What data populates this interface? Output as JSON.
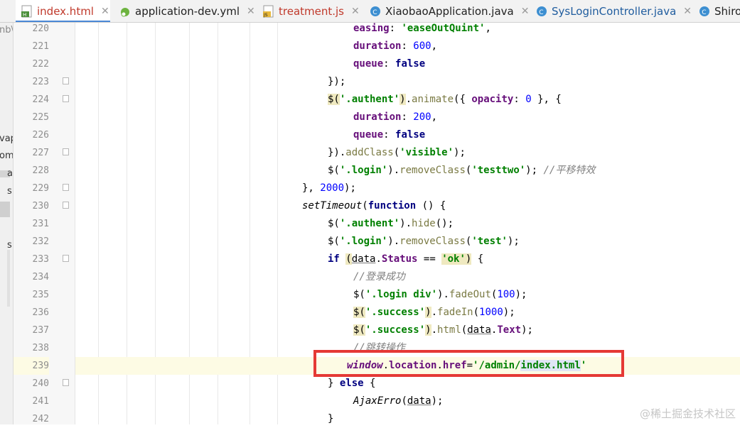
{
  "tabs": [
    {
      "label": "index.html",
      "icon": "html-file-icon",
      "modified": true,
      "active": true,
      "closable": true
    },
    {
      "label": "application-dev.yml",
      "icon": "yml-leaf-icon",
      "modified": false,
      "active": false,
      "closable": true
    },
    {
      "label": "treatment.js",
      "icon": "js-file-icon",
      "modified": true,
      "active": false,
      "closable": true
    },
    {
      "label": "XiaobaoApplication.java",
      "icon": "java-class-icon",
      "modified": false,
      "active": false,
      "closable": true
    },
    {
      "label": "SysLoginController.java",
      "icon": "java-class-icon",
      "modified": false,
      "active": false,
      "closable": true
    },
    {
      "label": "Shiro",
      "icon": "java-class-icon",
      "modified": false,
      "active": false,
      "closable": false
    }
  ],
  "side_fragments": [
    "nb\\",
    "vap",
    "om",
    "a",
    "s",
    "s"
  ],
  "line_numbers": [
    "220",
    "221",
    "222",
    "223",
    "224",
    "225",
    "226",
    "227",
    "228",
    "229",
    "230",
    "231",
    "232",
    "233",
    "234",
    "235",
    "236",
    "237",
    "238",
    "239",
    "240",
    "241",
    "242"
  ],
  "current_line": "239",
  "code": {
    "l220": {
      "prop": "easing",
      "str": "'easeOutQuint'"
    },
    "l221": {
      "prop": "duration",
      "num": "600"
    },
    "l222": {
      "prop": "queue",
      "kw": "false"
    },
    "l223": {
      "text": "});"
    },
    "l224": {
      "sel": "'.authent'",
      "method": "animate",
      "prop": "opacity",
      "num": "0"
    },
    "l225": {
      "prop": "duration",
      "num": "200"
    },
    "l226": {
      "prop": "queue",
      "kw": "false"
    },
    "l227": {
      "method": "addClass",
      "str": "'visible'"
    },
    "l228": {
      "sel": "'.login'",
      "method": "removeClass",
      "str": "'testtwo'",
      "comment": "//平移特效"
    },
    "l229": {
      "num": "2000"
    },
    "l230": {
      "fn": "setTimeout",
      "kw": "function"
    },
    "l231": {
      "sel": "'.authent'",
      "method": "hide"
    },
    "l232": {
      "sel": "'.login'",
      "method": "removeClass",
      "str": "'test'"
    },
    "l233": {
      "kw": "if",
      "obj": "data",
      "prop": "Status",
      "str": "'ok'"
    },
    "l234": {
      "comment": "//登录成功"
    },
    "l235": {
      "sel": "'.login div'",
      "method": "fadeOut",
      "num": "100"
    },
    "l236": {
      "sel": "'.success'",
      "method": "fadeIn",
      "num": "1000"
    },
    "l237": {
      "sel": "'.success'",
      "method": "html",
      "obj": "data",
      "prop": "Text"
    },
    "l238": {
      "comment": "//跳转操作"
    },
    "l239": {
      "win": "window",
      "prop1": "location",
      "prop2": "href",
      "str_a": "'/admin/",
      "str_b": "index.html",
      "str_c": "'"
    },
    "l240": {
      "kw": "else"
    },
    "l241": {
      "fn": "AjaxErro",
      "obj": "data"
    },
    "l242": {
      "text": "}"
    }
  },
  "watermark": "@稀土掘金技术社区",
  "colors": {
    "highlight_box": "#e53935",
    "keyword": "#000080",
    "property": "#660e7a",
    "string": "#008000",
    "number": "#0000ff",
    "comment": "#808080",
    "active_tab_underline": "#4a88d6"
  }
}
